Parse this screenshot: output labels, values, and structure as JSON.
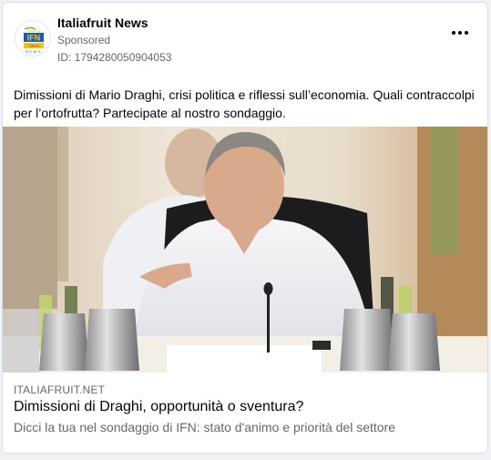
{
  "post": {
    "page_name": "Italiafruit News",
    "sponsored_label": "Sponsored",
    "ad_id": "ID: 1794280050904053",
    "body_text": "Dimissioni di Mario Draghi, crisi politica e riflessi sull’economia. Quali contraccolpi per l’ortofrutta? Partecipate al nostro sondaggio.",
    "logo_text": "IFN",
    "logo_subtext": "ITALIA",
    "logo_news": "NEWS"
  },
  "link_preview": {
    "domain": "ITALIAFRUIT.NET",
    "title": "Dimissioni di Draghi, opportunità o sventura?",
    "description": "Dicci la tua nel sondaggio di IFN: stato d'animo e priorità del settore"
  },
  "icons": {
    "more": "more-horizontal-icon",
    "avatar": "italiafruit-logo"
  },
  "colors": {
    "logo_blue": "#1e5aa8",
    "logo_yellow": "#f4c21a",
    "text_primary": "#050505",
    "text_secondary": "#65676b"
  }
}
